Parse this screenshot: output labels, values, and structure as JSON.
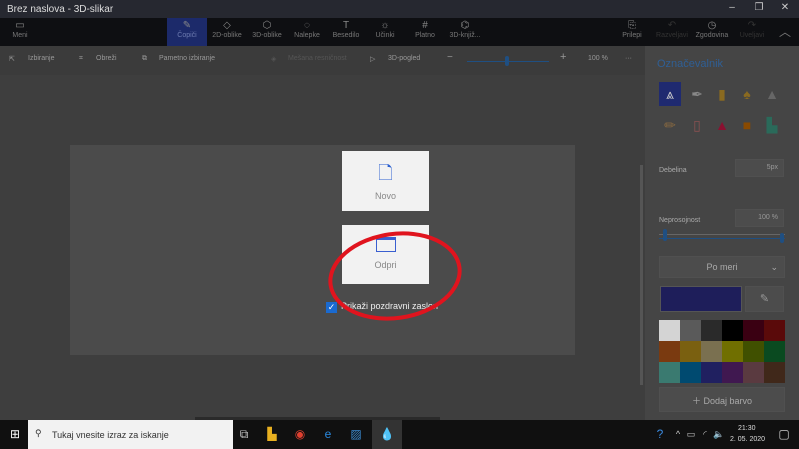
{
  "window": {
    "title": "Brez naslova - 3D-slikar",
    "minimize": "–",
    "restore": "❐",
    "close": "✕"
  },
  "ribbon": {
    "menu": "Meni",
    "tabs": [
      {
        "label": "Čopiči",
        "icon": "brush-icon"
      },
      {
        "label": "2D-oblike",
        "icon": "shapes2d-icon"
      },
      {
        "label": "3D-oblike",
        "icon": "cube-icon"
      },
      {
        "label": "Nalepke",
        "icon": "sticker-icon"
      },
      {
        "label": "Besedilo",
        "icon": "text-icon"
      },
      {
        "label": "Učinki",
        "icon": "effects-icon"
      },
      {
        "label": "Platno",
        "icon": "canvas-icon"
      },
      {
        "label": "3D-knjiž...",
        "icon": "library-icon"
      }
    ],
    "right": [
      {
        "label": "Prilepi"
      },
      {
        "label": "Razveljavi"
      },
      {
        "label": "Zgodovina"
      },
      {
        "label": "Uveljavi"
      }
    ]
  },
  "toolbar": {
    "select": "Izbiranje",
    "crop": "Obreži",
    "magic_select": "Pametno izbiranje",
    "mixed_reality": "Mešana resničnost",
    "view3d": "3D-pogled",
    "zoom": "100 %",
    "zoom_fraction": 0.5,
    "more": "···"
  },
  "panel": {
    "title": "Označevalnik",
    "thickness_label": "Debelina",
    "thickness": "5px",
    "thickness_fraction": 0.05,
    "opacity_label": "Neprosojnost",
    "opacity": "100 %",
    "opacity_fraction": 1.0,
    "mode": "Po meri",
    "current_color": "#1e1e5a",
    "add_color": "Dodaj barvo",
    "palette": [
      "#d4d4d4",
      "#5a5a5a",
      "#2a2a2a",
      "#000000",
      "#3a0012",
      "#5a0a0a",
      "#7a3a10",
      "#7a6010",
      "#7a7050",
      "#706f00",
      "#405000",
      "#0a4a20",
      "#3a7a70",
      "#004a70",
      "#202060",
      "#401850",
      "#5a3a40",
      "#40281a"
    ]
  },
  "dialog": {
    "new": "Novo",
    "open": "Odpri",
    "show_welcome": "Prikaži pozdravni zaslon"
  },
  "taskbar": {
    "search_placeholder": "Tukaj vnesite izraz za iskanje",
    "time": "21:30",
    "date": "2. 05. 2020"
  }
}
